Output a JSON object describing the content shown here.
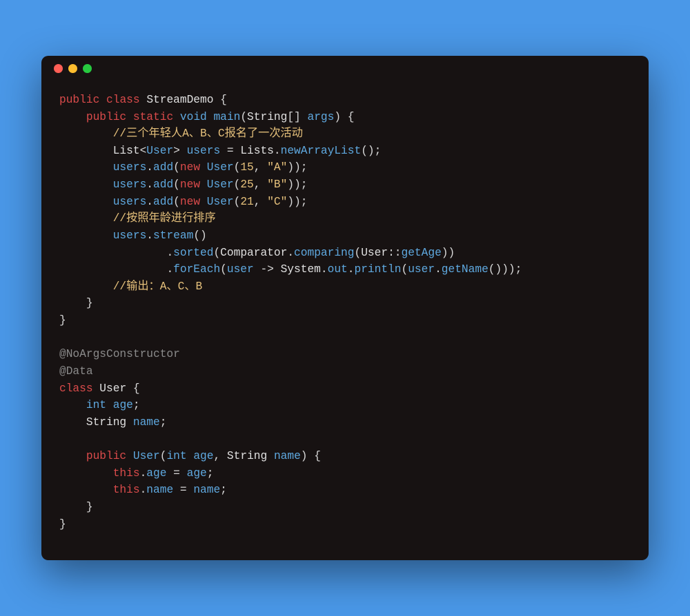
{
  "colors": {
    "background": "#4a98e8",
    "window": "#171212",
    "red_dot": "#ff5f56",
    "yellow_dot": "#ffbd2e",
    "green_dot": "#27c93f",
    "keyword_red": "#db4b4b",
    "keyword_blue": "#5fa9e0",
    "string": "#e5c07b",
    "comment": "#e5c07b",
    "annotation": "#8b8b8b",
    "default": "#d8d8d8"
  },
  "code": {
    "tokens": [
      [
        [
          "kw-red",
          "public"
        ],
        [
          "",
          null,
          " "
        ],
        [
          "kw-red",
          "class"
        ],
        [
          "",
          null,
          " "
        ],
        [
          "ident",
          "StreamDemo"
        ],
        [
          "",
          null,
          " {"
        ]
      ],
      [
        [
          "",
          null,
          "    "
        ],
        [
          "kw-red",
          "public"
        ],
        [
          "",
          null,
          " "
        ],
        [
          "kw-red",
          "static"
        ],
        [
          "",
          null,
          " "
        ],
        [
          "kw-blue",
          "void"
        ],
        [
          "",
          null,
          " "
        ],
        [
          "fn",
          "main"
        ],
        [
          "",
          null,
          "("
        ],
        [
          "type",
          "String"
        ],
        [
          "",
          null,
          "[] "
        ],
        [
          "var",
          "args"
        ],
        [
          "",
          null,
          ") {"
        ]
      ],
      [
        [
          "",
          null,
          "        "
        ],
        [
          "comment",
          "//三个年轻人A、B、C报名了一次活动"
        ]
      ],
      [
        [
          "",
          null,
          "        "
        ],
        [
          "type",
          "List"
        ],
        [
          "",
          null,
          "<"
        ],
        [
          "var",
          "User"
        ],
        [
          "",
          null,
          "> "
        ],
        [
          "var",
          "users"
        ],
        [
          "",
          null,
          " = "
        ],
        [
          "type",
          "Lists"
        ],
        [
          "",
          null,
          "."
        ],
        [
          "fn",
          "newArrayList"
        ],
        [
          "",
          null,
          "();"
        ]
      ],
      [
        [
          "",
          null,
          "        "
        ],
        [
          "var",
          "users"
        ],
        [
          "",
          null,
          "."
        ],
        [
          "fn",
          "add"
        ],
        [
          "",
          null,
          "("
        ],
        [
          "kw-red",
          "new"
        ],
        [
          "",
          null,
          " "
        ],
        [
          "fn",
          "User"
        ],
        [
          "",
          null,
          "("
        ],
        [
          "num",
          "15"
        ],
        [
          "",
          null,
          ", "
        ],
        [
          "str",
          "\"A\""
        ],
        [
          "",
          null,
          "));"
        ]
      ],
      [
        [
          "",
          null,
          "        "
        ],
        [
          "var",
          "users"
        ],
        [
          "",
          null,
          "."
        ],
        [
          "fn",
          "add"
        ],
        [
          "",
          null,
          "("
        ],
        [
          "kw-red",
          "new"
        ],
        [
          "",
          null,
          " "
        ],
        [
          "fn",
          "User"
        ],
        [
          "",
          null,
          "("
        ],
        [
          "num",
          "25"
        ],
        [
          "",
          null,
          ", "
        ],
        [
          "str",
          "\"B\""
        ],
        [
          "",
          null,
          "));"
        ]
      ],
      [
        [
          "",
          null,
          "        "
        ],
        [
          "var",
          "users"
        ],
        [
          "",
          null,
          "."
        ],
        [
          "fn",
          "add"
        ],
        [
          "",
          null,
          "("
        ],
        [
          "kw-red",
          "new"
        ],
        [
          "",
          null,
          " "
        ],
        [
          "fn",
          "User"
        ],
        [
          "",
          null,
          "("
        ],
        [
          "num",
          "21"
        ],
        [
          "",
          null,
          ", "
        ],
        [
          "str",
          "\"C\""
        ],
        [
          "",
          null,
          "));"
        ]
      ],
      [
        [
          "",
          null,
          "        "
        ],
        [
          "comment",
          "//按照年龄进行排序"
        ]
      ],
      [
        [
          "",
          null,
          "        "
        ],
        [
          "var",
          "users"
        ],
        [
          "",
          null,
          "."
        ],
        [
          "fn",
          "stream"
        ],
        [
          "",
          null,
          "()"
        ]
      ],
      [
        [
          "",
          null,
          "                "
        ],
        [
          "",
          null,
          "."
        ],
        [
          "fn",
          "sorted"
        ],
        [
          "",
          null,
          "("
        ],
        [
          "type",
          "Comparator"
        ],
        [
          "",
          null,
          "."
        ],
        [
          "fn",
          "comparing"
        ],
        [
          "",
          null,
          "("
        ],
        [
          "type",
          "User"
        ],
        [
          "",
          null,
          "::"
        ],
        [
          "var",
          "getAge"
        ],
        [
          "",
          null,
          "))"
        ]
      ],
      [
        [
          "",
          null,
          "                "
        ],
        [
          "",
          null,
          "."
        ],
        [
          "fn",
          "forEach"
        ],
        [
          "",
          null,
          "("
        ],
        [
          "var",
          "user"
        ],
        [
          "",
          null,
          " -> "
        ],
        [
          "type",
          "System"
        ],
        [
          "",
          null,
          "."
        ],
        [
          "var",
          "out"
        ],
        [
          "",
          null,
          "."
        ],
        [
          "fn",
          "println"
        ],
        [
          "",
          null,
          "("
        ],
        [
          "var",
          "user"
        ],
        [
          "",
          null,
          "."
        ],
        [
          "fn",
          "getName"
        ],
        [
          "",
          null,
          "()));"
        ]
      ],
      [
        [
          "",
          null,
          "        "
        ],
        [
          "comment",
          "//输出：A、C、B"
        ]
      ],
      [
        [
          "",
          null,
          "    }"
        ]
      ],
      [
        [
          "",
          null,
          "}"
        ]
      ],
      [
        [
          "",
          null,
          ""
        ]
      ],
      [
        [
          "anno",
          "@NoArgsConstructor"
        ]
      ],
      [
        [
          "anno",
          "@Data"
        ]
      ],
      [
        [
          "kw-red",
          "class"
        ],
        [
          "",
          null,
          " "
        ],
        [
          "ident",
          "User"
        ],
        [
          "",
          null,
          " {"
        ]
      ],
      [
        [
          "",
          null,
          "    "
        ],
        [
          "kw-blue",
          "int"
        ],
        [
          "",
          null,
          " "
        ],
        [
          "var",
          "age"
        ],
        [
          "",
          null,
          ";"
        ]
      ],
      [
        [
          "",
          null,
          "    "
        ],
        [
          "type",
          "String"
        ],
        [
          "",
          null,
          " "
        ],
        [
          "var",
          "name"
        ],
        [
          "",
          null,
          ";"
        ]
      ],
      [
        [
          "",
          null,
          ""
        ]
      ],
      [
        [
          "",
          null,
          "    "
        ],
        [
          "kw-red",
          "public"
        ],
        [
          "",
          null,
          " "
        ],
        [
          "fn",
          "User"
        ],
        [
          "",
          null,
          "("
        ],
        [
          "kw-blue",
          "int"
        ],
        [
          "",
          null,
          " "
        ],
        [
          "var",
          "age"
        ],
        [
          "",
          null,
          ", "
        ],
        [
          "type",
          "String"
        ],
        [
          "",
          null,
          " "
        ],
        [
          "var",
          "name"
        ],
        [
          "",
          null,
          ") {"
        ]
      ],
      [
        [
          "",
          null,
          "        "
        ],
        [
          "kw-red",
          "this"
        ],
        [
          "",
          null,
          "."
        ],
        [
          "var",
          "age"
        ],
        [
          "",
          null,
          " = "
        ],
        [
          "var",
          "age"
        ],
        [
          "",
          null,
          ";"
        ]
      ],
      [
        [
          "",
          null,
          "        "
        ],
        [
          "kw-red",
          "this"
        ],
        [
          "",
          null,
          "."
        ],
        [
          "var",
          "name"
        ],
        [
          "",
          null,
          " = "
        ],
        [
          "var",
          "name"
        ],
        [
          "",
          null,
          ";"
        ]
      ],
      [
        [
          "",
          null,
          "    }"
        ]
      ],
      [
        [
          "",
          null,
          "}"
        ]
      ]
    ]
  }
}
